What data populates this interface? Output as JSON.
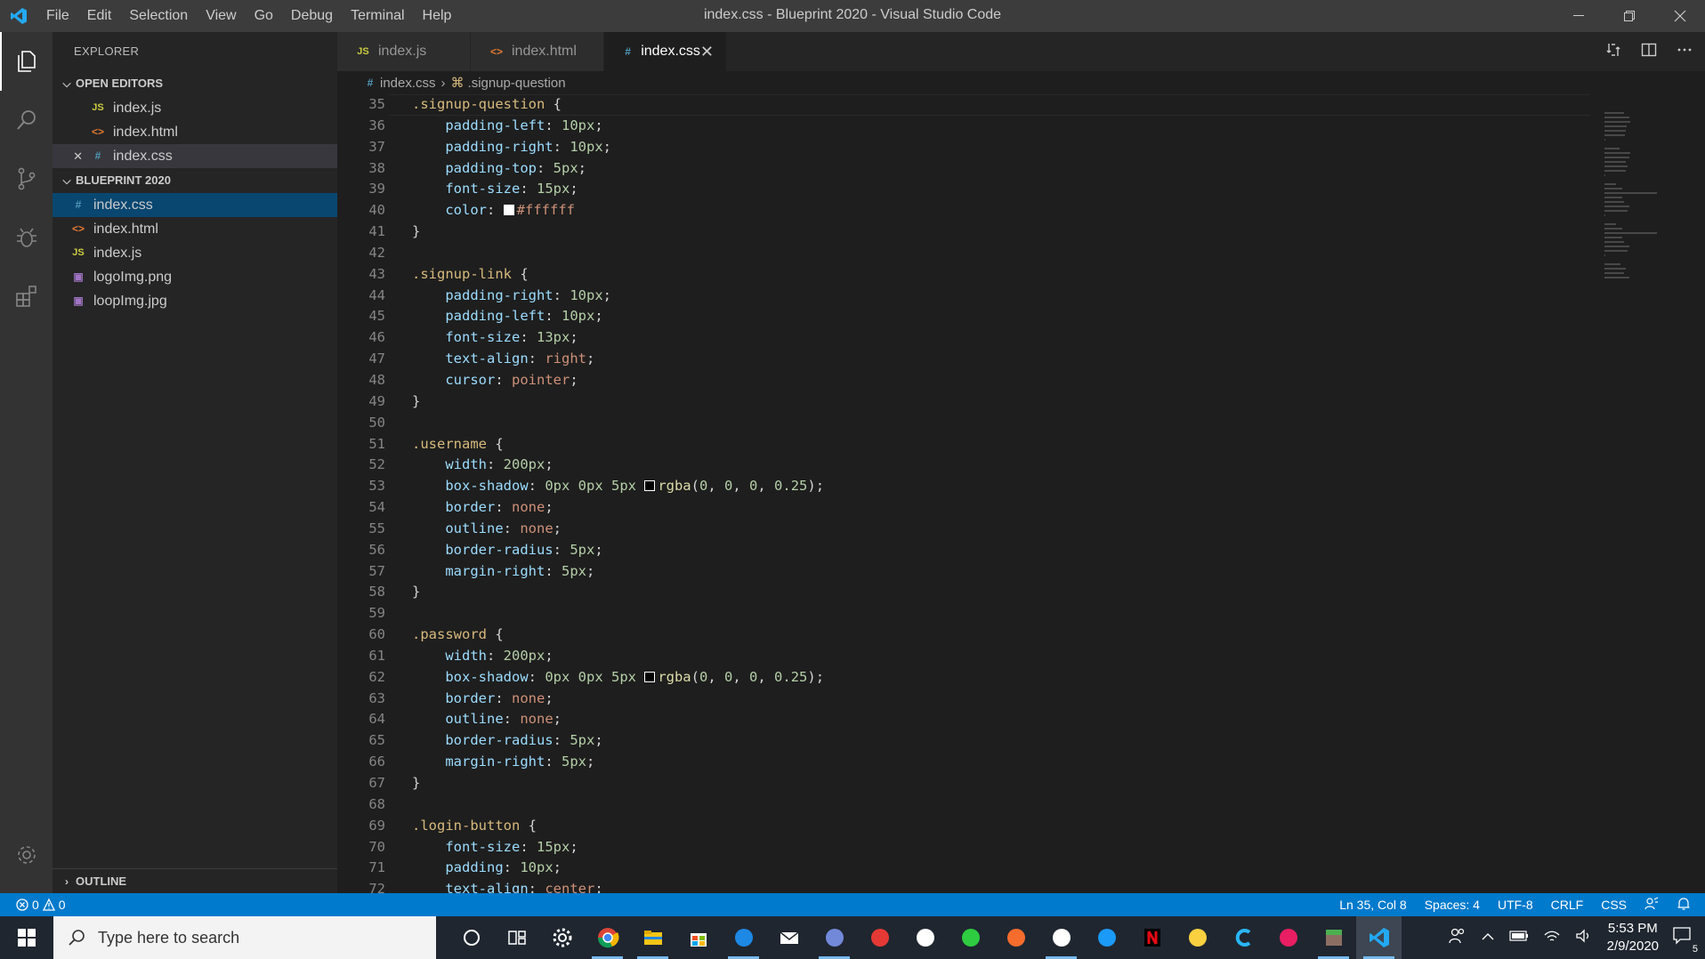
{
  "window": {
    "title": "index.css - Blueprint 2020 - Visual Studio Code",
    "menu": [
      "File",
      "Edit",
      "Selection",
      "View",
      "Go",
      "Debug",
      "Terminal",
      "Help"
    ]
  },
  "sidebar": {
    "title": "EXPLORER",
    "open_editors_label": "OPEN EDITORS",
    "open_editors": [
      {
        "name": "index.js",
        "type": "js"
      },
      {
        "name": "index.html",
        "type": "html"
      },
      {
        "name": "index.css",
        "type": "css"
      }
    ],
    "project_label": "BLUEPRINT 2020",
    "files": [
      {
        "name": "index.css",
        "type": "css"
      },
      {
        "name": "index.html",
        "type": "html"
      },
      {
        "name": "index.js",
        "type": "js"
      },
      {
        "name": "logoImg.png",
        "type": "img"
      },
      {
        "name": "loopImg.jpg",
        "type": "img"
      }
    ],
    "outline_label": "OUTLINE",
    "js_icon": "JS",
    "close_glyph": "✕"
  },
  "tabs": [
    {
      "label": "index.js",
      "icon": "JS",
      "active": false
    },
    {
      "label": "index.html",
      "icon": "<>",
      "active": false
    },
    {
      "label": "index.css",
      "icon": "#",
      "active": true
    }
  ],
  "breadcrumb": {
    "file": "index.css",
    "symbol": ".signup-question"
  },
  "code_lines": [
    {
      "n": "35",
      "tokens": [
        [
          "sel",
          ".signup-question"
        ],
        [
          "punc",
          " {"
        ]
      ]
    },
    {
      "n": "36",
      "tokens": [
        [
          "ind",
          "    "
        ],
        [
          "prop",
          "padding-left"
        ],
        [
          "punc",
          ": "
        ],
        [
          "num",
          "10px"
        ],
        [
          "punc",
          ";"
        ]
      ]
    },
    {
      "n": "37",
      "tokens": [
        [
          "ind",
          "    "
        ],
        [
          "prop",
          "padding-right"
        ],
        [
          "punc",
          ": "
        ],
        [
          "num",
          "10px"
        ],
        [
          "punc",
          ";"
        ]
      ]
    },
    {
      "n": "38",
      "tokens": [
        [
          "ind",
          "    "
        ],
        [
          "prop",
          "padding-top"
        ],
        [
          "punc",
          ": "
        ],
        [
          "num",
          "5px"
        ],
        [
          "punc",
          ";"
        ]
      ]
    },
    {
      "n": "39",
      "tokens": [
        [
          "ind",
          "    "
        ],
        [
          "prop",
          "font-size"
        ],
        [
          "punc",
          ": "
        ],
        [
          "num",
          "15px"
        ],
        [
          "punc",
          ";"
        ]
      ]
    },
    {
      "n": "40",
      "tokens": [
        [
          "ind",
          "    "
        ],
        [
          "prop",
          "color"
        ],
        [
          "punc",
          ": "
        ],
        [
          "swatch-white",
          ""
        ],
        [
          "kw",
          "#ffffff"
        ]
      ]
    },
    {
      "n": "41",
      "tokens": [
        [
          "punc",
          "}"
        ]
      ]
    },
    {
      "n": "42",
      "tokens": []
    },
    {
      "n": "43",
      "tokens": [
        [
          "sel",
          ".signup-link"
        ],
        [
          "punc",
          " {"
        ]
      ]
    },
    {
      "n": "44",
      "tokens": [
        [
          "ind",
          "    "
        ],
        [
          "prop",
          "padding-right"
        ],
        [
          "punc",
          ": "
        ],
        [
          "num",
          "10px"
        ],
        [
          "punc",
          ";"
        ]
      ]
    },
    {
      "n": "45",
      "tokens": [
        [
          "ind",
          "    "
        ],
        [
          "prop",
          "padding-left"
        ],
        [
          "punc",
          ": "
        ],
        [
          "num",
          "10px"
        ],
        [
          "punc",
          ";"
        ]
      ]
    },
    {
      "n": "46",
      "tokens": [
        [
          "ind",
          "    "
        ],
        [
          "prop",
          "font-size"
        ],
        [
          "punc",
          ": "
        ],
        [
          "num",
          "13px"
        ],
        [
          "punc",
          ";"
        ]
      ]
    },
    {
      "n": "47",
      "tokens": [
        [
          "ind",
          "    "
        ],
        [
          "prop",
          "text-align"
        ],
        [
          "punc",
          ": "
        ],
        [
          "kw",
          "right"
        ],
        [
          "punc",
          ";"
        ]
      ]
    },
    {
      "n": "48",
      "tokens": [
        [
          "ind",
          "    "
        ],
        [
          "prop",
          "cursor"
        ],
        [
          "punc",
          ": "
        ],
        [
          "kw",
          "pointer"
        ],
        [
          "punc",
          ";"
        ]
      ]
    },
    {
      "n": "49",
      "tokens": [
        [
          "punc",
          "}"
        ]
      ]
    },
    {
      "n": "50",
      "tokens": []
    },
    {
      "n": "51",
      "tokens": [
        [
          "sel",
          ".username"
        ],
        [
          "punc",
          " {"
        ]
      ]
    },
    {
      "n": "52",
      "tokens": [
        [
          "ind",
          "    "
        ],
        [
          "prop",
          "width"
        ],
        [
          "punc",
          ": "
        ],
        [
          "num",
          "200px"
        ],
        [
          "punc",
          ";"
        ]
      ]
    },
    {
      "n": "53",
      "tokens": [
        [
          "ind",
          "    "
        ],
        [
          "prop",
          "box-shadow"
        ],
        [
          "punc",
          ": "
        ],
        [
          "num",
          "0px 0px 5px "
        ],
        [
          "swatch-black",
          ""
        ],
        [
          "fn",
          "rgba"
        ],
        [
          "punc",
          "("
        ],
        [
          "num",
          "0"
        ],
        [
          "punc",
          ", "
        ],
        [
          "num",
          "0"
        ],
        [
          "punc",
          ", "
        ],
        [
          "num",
          "0"
        ],
        [
          "punc",
          ", "
        ],
        [
          "num",
          "0.25"
        ],
        [
          "punc",
          ");"
        ]
      ]
    },
    {
      "n": "54",
      "tokens": [
        [
          "ind",
          "    "
        ],
        [
          "prop",
          "border"
        ],
        [
          "punc",
          ": "
        ],
        [
          "kw",
          "none"
        ],
        [
          "punc",
          ";"
        ]
      ]
    },
    {
      "n": "55",
      "tokens": [
        [
          "ind",
          "    "
        ],
        [
          "prop",
          "outline"
        ],
        [
          "punc",
          ": "
        ],
        [
          "kw",
          "none"
        ],
        [
          "punc",
          ";"
        ]
      ]
    },
    {
      "n": "56",
      "tokens": [
        [
          "ind",
          "    "
        ],
        [
          "prop",
          "border-radius"
        ],
        [
          "punc",
          ": "
        ],
        [
          "num",
          "5px"
        ],
        [
          "punc",
          ";"
        ]
      ]
    },
    {
      "n": "57",
      "tokens": [
        [
          "ind",
          "    "
        ],
        [
          "prop",
          "margin-right"
        ],
        [
          "punc",
          ": "
        ],
        [
          "num",
          "5px"
        ],
        [
          "punc",
          ";"
        ]
      ]
    },
    {
      "n": "58",
      "tokens": [
        [
          "punc",
          "}"
        ]
      ]
    },
    {
      "n": "59",
      "tokens": []
    },
    {
      "n": "60",
      "tokens": [
        [
          "sel",
          ".password"
        ],
        [
          "punc",
          " {"
        ]
      ]
    },
    {
      "n": "61",
      "tokens": [
        [
          "ind",
          "    "
        ],
        [
          "prop",
          "width"
        ],
        [
          "punc",
          ": "
        ],
        [
          "num",
          "200px"
        ],
        [
          "punc",
          ";"
        ]
      ]
    },
    {
      "n": "62",
      "tokens": [
        [
          "ind",
          "    "
        ],
        [
          "prop",
          "box-shadow"
        ],
        [
          "punc",
          ": "
        ],
        [
          "num",
          "0px 0px 5px "
        ],
        [
          "swatch-black",
          ""
        ],
        [
          "fn",
          "rgba"
        ],
        [
          "punc",
          "("
        ],
        [
          "num",
          "0"
        ],
        [
          "punc",
          ", "
        ],
        [
          "num",
          "0"
        ],
        [
          "punc",
          ", "
        ],
        [
          "num",
          "0"
        ],
        [
          "punc",
          ", "
        ],
        [
          "num",
          "0.25"
        ],
        [
          "punc",
          ");"
        ]
      ]
    },
    {
      "n": "63",
      "tokens": [
        [
          "ind",
          "    "
        ],
        [
          "prop",
          "border"
        ],
        [
          "punc",
          ": "
        ],
        [
          "kw",
          "none"
        ],
        [
          "punc",
          ";"
        ]
      ]
    },
    {
      "n": "64",
      "tokens": [
        [
          "ind",
          "    "
        ],
        [
          "prop",
          "outline"
        ],
        [
          "punc",
          ": "
        ],
        [
          "kw",
          "none"
        ],
        [
          "punc",
          ";"
        ]
      ]
    },
    {
      "n": "65",
      "tokens": [
        [
          "ind",
          "    "
        ],
        [
          "prop",
          "border-radius"
        ],
        [
          "punc",
          ": "
        ],
        [
          "num",
          "5px"
        ],
        [
          "punc",
          ";"
        ]
      ]
    },
    {
      "n": "66",
      "tokens": [
        [
          "ind",
          "    "
        ],
        [
          "prop",
          "margin-right"
        ],
        [
          "punc",
          ": "
        ],
        [
          "num",
          "5px"
        ],
        [
          "punc",
          ";"
        ]
      ]
    },
    {
      "n": "67",
      "tokens": [
        [
          "punc",
          "}"
        ]
      ]
    },
    {
      "n": "68",
      "tokens": []
    },
    {
      "n": "69",
      "tokens": [
        [
          "sel",
          ".login-button"
        ],
        [
          "punc",
          " {"
        ]
      ]
    },
    {
      "n": "70",
      "tokens": [
        [
          "ind",
          "    "
        ],
        [
          "prop",
          "font-size"
        ],
        [
          "punc",
          ": "
        ],
        [
          "num",
          "15px"
        ],
        [
          "punc",
          ";"
        ]
      ]
    },
    {
      "n": "71",
      "tokens": [
        [
          "ind",
          "    "
        ],
        [
          "prop",
          "padding"
        ],
        [
          "punc",
          ": "
        ],
        [
          "num",
          "10px"
        ],
        [
          "punc",
          ";"
        ]
      ]
    },
    {
      "n": "72",
      "tokens": [
        [
          "ind",
          "    "
        ],
        [
          "prop",
          "text-align"
        ],
        [
          "punc",
          ": "
        ],
        [
          "kw",
          "center"
        ],
        [
          "punc",
          ";"
        ]
      ]
    }
  ],
  "status": {
    "errors": "0",
    "warnings": "0",
    "position": "Ln 35, Col 8",
    "spaces": "Spaces: 4",
    "encoding": "UTF-8",
    "eol": "CRLF",
    "language": "CSS"
  },
  "taskbar": {
    "search_placeholder": "Type here to search",
    "time": "5:53 PM",
    "date": "2/9/2020",
    "notification_count": "5",
    "apps": [
      "cortana-circle",
      "task-view",
      "settings",
      "chrome",
      "file-explorer",
      "store",
      "remote-desktop",
      "mail",
      "discord",
      "chrome-canary",
      "microphone",
      "cloud-app",
      "origin",
      "steam",
      "battlenet",
      "netflix",
      "osu",
      "cortana-c",
      "flux",
      "minecraft",
      "vscode"
    ]
  },
  "colors": {
    "accent": "#007acc",
    "selection": "#094771",
    "selector": "#d7ba7d",
    "property": "#9cdcfe",
    "number": "#b5cea8",
    "keyword": "#ce9178"
  }
}
